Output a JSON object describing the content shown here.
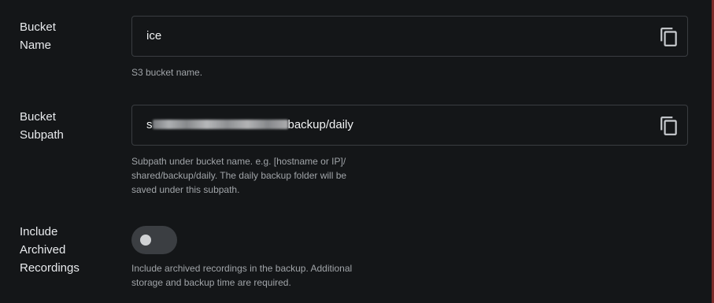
{
  "fields": {
    "bucket_name": {
      "label": "Bucket\nName",
      "value": "ice",
      "help": "S3 bucket name."
    },
    "bucket_subpath": {
      "label": "Bucket\nSubpath",
      "value_prefix": "s",
      "value_suffix": "backup/daily",
      "help": "Subpath under bucket name.  e.g. [hostname or IP]/\nshared/backup/daily.  The daily backup folder will be\nsaved under this subpath."
    },
    "include_archived": {
      "label": "Include\nArchived\nRecordings",
      "toggle_on": false,
      "help": "Include archived recordings in the backup.  Additional\nstorage and backup time are required."
    }
  },
  "icons": {
    "copy": "copy-icon"
  },
  "colors": {
    "background": "#141618",
    "border": "#3a3d41",
    "text": "#e8eaed",
    "help_text": "#a0a4a8",
    "accent_edge": "#7a2a2a"
  }
}
